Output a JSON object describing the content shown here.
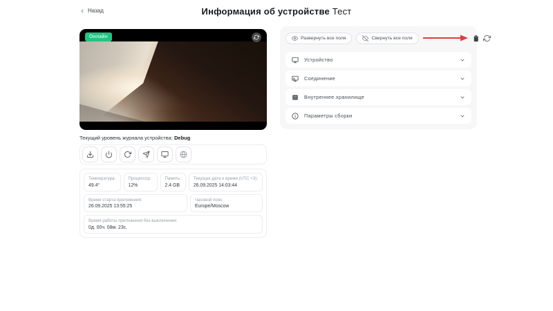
{
  "page": {
    "back_label": "Назад",
    "title_main": "Информация об устройстве",
    "title_suffix": "Тест"
  },
  "device_preview": {
    "status_badge": "Онлайн",
    "status_badge_color": "#23c483",
    "overlay_icon": "refresh-icon",
    "log_level_label": "Текущий уровень журнала устройства:",
    "log_level_value": "Debug"
  },
  "action_buttons": [
    {
      "icon": "download-icon"
    },
    {
      "icon": "power-icon"
    },
    {
      "icon": "restart-icon"
    },
    {
      "icon": "send-icon"
    },
    {
      "icon": "display-icon"
    },
    {
      "icon": "globe-icon"
    }
  ],
  "stats": {
    "cards": [
      {
        "label": "Температура:",
        "value": "49.4°"
      },
      {
        "label": "Процессор:",
        "value": "12%"
      },
      {
        "label": "Память:",
        "value": "2.4 GB"
      },
      {
        "label": "Текущая дата и время (UTC +3):",
        "value": "26.09.2025 14:03:44"
      },
      {
        "label": "Время старта приложения:",
        "value": "26.09.2025 13:55:25"
      },
      {
        "label": "Часовой пояс:",
        "value": "Europe/Moscow"
      },
      {
        "label": "Время работы приложения без выключения:",
        "value": "0д. 00ч. 08м. 23с."
      }
    ]
  },
  "panel": {
    "expand_all_label": "Развернуть все поля",
    "collapse_all_label": "Свернуть все поля",
    "annotation_arrow_color": "#e23b3b",
    "toolbar_icons": [
      "copy-icon",
      "refresh-icon"
    ],
    "sections": [
      {
        "label": "Устройство",
        "icon": "display-icon"
      },
      {
        "label": "Соединение",
        "icon": "connection-icon"
      },
      {
        "label": "Внутреннее хранилище",
        "icon": "storage-icon"
      },
      {
        "label": "Параметры сборки",
        "icon": "info-icon"
      }
    ]
  }
}
